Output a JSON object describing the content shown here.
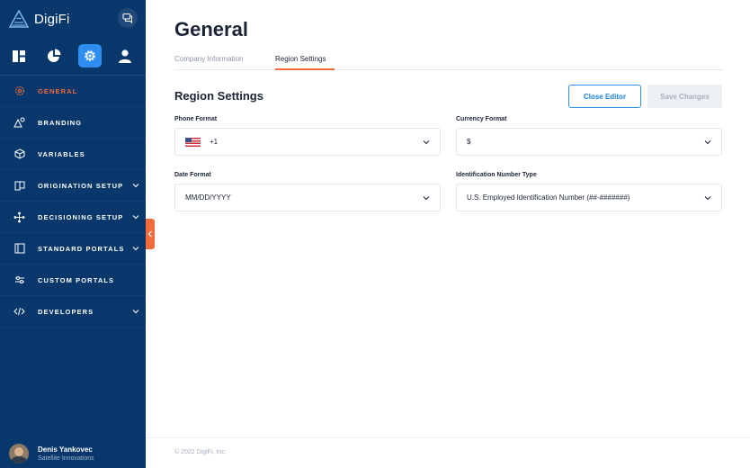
{
  "sidebar": {
    "brand_name": "DigiFi",
    "top_icons": [
      "dashboard-icon",
      "pie-chart-icon",
      "gear-icon",
      "user-icon"
    ],
    "items": [
      {
        "label": "GENERAL",
        "icon": "gear-icon",
        "active": true,
        "expandable": false
      },
      {
        "label": "BRANDING",
        "icon": "brush-icon",
        "active": false,
        "expandable": false
      },
      {
        "label": "VARIABLES",
        "icon": "cube-icon",
        "active": false,
        "expandable": false
      },
      {
        "label": "ORIGINATION SETUP",
        "icon": "book-icon",
        "active": false,
        "expandable": true
      },
      {
        "label": "DECISIONING SETUP",
        "icon": "flow-icon",
        "active": false,
        "expandable": true
      },
      {
        "label": "STANDARD PORTALS",
        "icon": "layout-icon",
        "active": false,
        "expandable": true
      },
      {
        "label": "CUSTOM PORTALS",
        "icon": "sliders-icon",
        "active": false,
        "expandable": false
      },
      {
        "label": "DEVELOPERS",
        "icon": "code-icon",
        "active": false,
        "expandable": true
      }
    ],
    "user": {
      "name": "Denis Yankovec",
      "org": "Satellite Innovations"
    }
  },
  "main": {
    "title": "General",
    "tabs": [
      {
        "label": "Company Information",
        "active": false
      },
      {
        "label": "Region Settings",
        "active": true
      }
    ],
    "section_title": "Region Settings",
    "buttons": {
      "close": "Close Editor",
      "save": "Save Changes"
    },
    "fields": {
      "phone_format": {
        "label": "Phone Format",
        "value": "+1"
      },
      "currency_format": {
        "label": "Currency Format",
        "value": "$"
      },
      "date_format": {
        "label": "Date Format",
        "value": "MM/DD/YYYY"
      },
      "id_number_type": {
        "label": "Identification Number Type",
        "value": "U.S. Employed Identification Number (##-#######)"
      }
    },
    "footer": "© 2022 DigiFi, Inc."
  },
  "colors": {
    "sidebar_bg": "#07376b",
    "accent_orange": "#f26b3a",
    "accent_blue": "#2e8ef0",
    "text_dark": "#1b2437"
  }
}
